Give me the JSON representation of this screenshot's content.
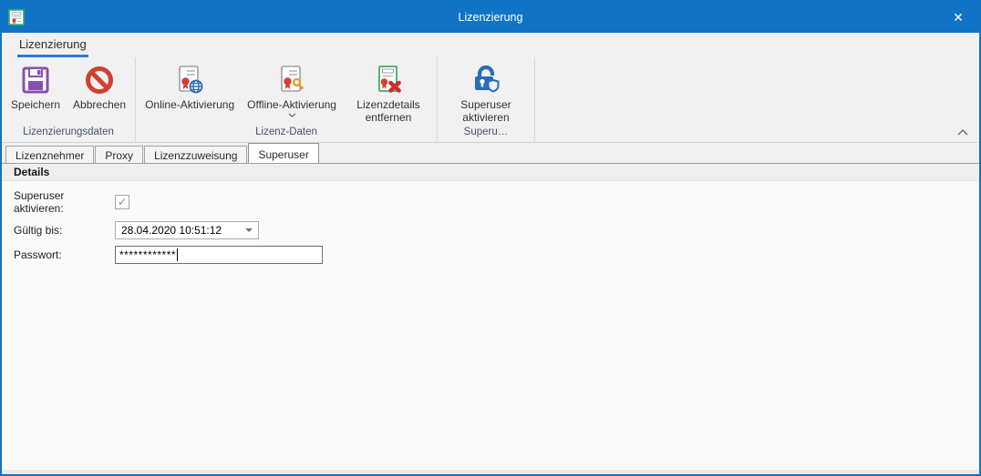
{
  "window": {
    "title": "Lizenzierung"
  },
  "titlebar": {
    "close_icon": "✕"
  },
  "ribbon": {
    "tab_label": "Lizenzierung",
    "groups": [
      {
        "caption": "Lizenzierungsdaten",
        "buttons": [
          {
            "label": "Speichern",
            "icon": "floppy-disk-icon"
          },
          {
            "label": "Abbrechen",
            "icon": "cancel-icon"
          }
        ]
      },
      {
        "caption": "Lizenz-Daten",
        "buttons": [
          {
            "label": "Online-Aktivierung",
            "icon": "certificate-globe-icon"
          },
          {
            "label": "Offline-Aktivierung",
            "icon": "certificate-key-icon",
            "has_dropdown": true
          },
          {
            "label": "Lizenzdetails entfernen",
            "icon": "certificate-remove-icon"
          }
        ]
      },
      {
        "caption": "Superu…",
        "buttons": [
          {
            "label": "Superuser aktivieren",
            "icon": "lock-shield-icon"
          }
        ]
      }
    ]
  },
  "page_tabs": [
    {
      "label": "Lizenznehmer",
      "active": false
    },
    {
      "label": "Proxy",
      "active": false
    },
    {
      "label": "Lizenzzuweisung",
      "active": false
    },
    {
      "label": "Superuser",
      "active": true
    }
  ],
  "details": {
    "section_title": "Details",
    "superuser_field": {
      "label": "Superuser aktivieren:",
      "checked": true,
      "check_glyph": "✓"
    },
    "valid_until_field": {
      "label": "Gültig bis:",
      "value": "28.04.2020 10:51:12"
    },
    "password_field": {
      "label": "Passwort:",
      "value": "************"
    }
  },
  "colors": {
    "accent_blue": "#1173c5",
    "tab_underline": "#2a7cd4",
    "save_purple": "#8a4fae",
    "cancel_red": "#d2402f",
    "seal_red": "#cf4232",
    "key_gold": "#dfa032",
    "cert_green": "#3fae68",
    "lock_blue": "#2b6cb8"
  }
}
